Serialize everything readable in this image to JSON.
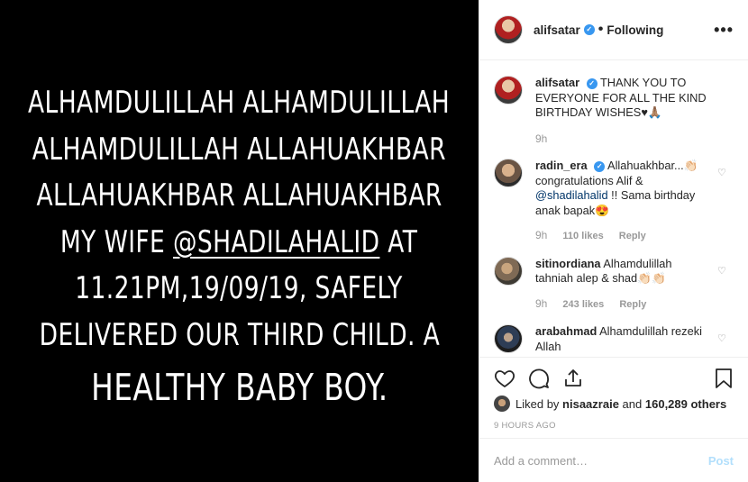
{
  "post_image": {
    "lines": [
      "ALHAMDULILLAH ALHAMDULILLAH",
      "ALHAMDULILLAH ALLAHUAKHBAR",
      "ALLAHUAKHBAR ALLAHUAKHBAR",
      "MY WIFE ",
      "@SHADILAHALID",
      " AT",
      "11.21PM,19/09/19, SAFELY",
      "DELIVERED OUR THIRD CHILD. A",
      "HEALTHY BABY BOY."
    ]
  },
  "header": {
    "username": "alifsatar",
    "verified_icon": "verified-badge-icon",
    "separator": "•",
    "follow_status": "Following",
    "more_label": "•••"
  },
  "caption": {
    "username": "alifsatar",
    "text": "THANK YOU TO EVERYONE FOR ALL THE KIND BIRTHDAY WISHES♥🙏🏽",
    "time": "9h"
  },
  "comments": [
    {
      "username": "radin_era",
      "text_before": " Allahuakhbar...👏🏻 congratulations Alif & ",
      "mention": "@shadilahalid",
      "text_after": " !! Sama birthday anak bapak😍",
      "time": "9h",
      "likes": "110 likes",
      "reply": "Reply"
    },
    {
      "username": "sitinordiana",
      "text": " Alhamdulillah tahniah alep & shad👏🏻👏🏻",
      "time": "9h",
      "likes": "243 likes",
      "reply": "Reply"
    },
    {
      "username": "arabahmad",
      "text": " Alhamdulillah rezeki Allah"
    }
  ],
  "actions": {
    "liked_by_prefix": "Liked by ",
    "liked_by_user": "nisaazraie",
    "liked_by_and": " and ",
    "liked_by_others": "160,289 others",
    "time_ago": "9 HOURS AGO"
  },
  "add_comment": {
    "placeholder": "Add a comment…",
    "post_label": "Post"
  },
  "colors": {
    "link": "#003569",
    "verified": "#3897f0",
    "post_button": "#b2dffc",
    "image_bg": "#000000"
  }
}
